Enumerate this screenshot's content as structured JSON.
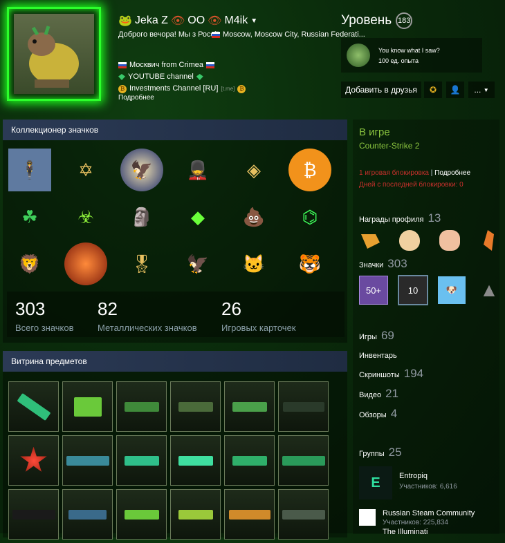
{
  "profile": {
    "name_prefix": "Jeka Z",
    "name_mid": "OO",
    "name_suffix": "M4ik",
    "greeting": "Доброго вечора! Мы з Россії",
    "location": "Moscow, Moscow City, Russian Federati...",
    "summary": {
      "line1": "Москвич from Crimea",
      "line2": "YOUTUBE channel",
      "line3": "Investments Channel [RU]",
      "line3_suffix": "[t.me]"
    },
    "more_link": "Подробнее"
  },
  "level": {
    "title": "Уровень",
    "value": "183",
    "featured_badge": {
      "name": "You know what I saw?",
      "xp": "100 ед. опыта"
    }
  },
  "actions": {
    "add_friend": "Добавить в друзья",
    "more": "..."
  },
  "badge_showcase": {
    "title": "Коллекционер значков",
    "badges": [
      "portrait",
      "star-portrait",
      "seal",
      "soldier",
      "portrait-diamond",
      "bitcoin",
      "celtic",
      "biohazard",
      "statue",
      "crystal",
      "poop-fire",
      "circuit",
      "lion",
      "lava-ball",
      "medal",
      "eagle",
      "cat",
      "tiger"
    ],
    "stats": [
      {
        "value": "303",
        "label": "Всего значков"
      },
      {
        "value": "82",
        "label": "Металлических значков"
      },
      {
        "value": "26",
        "label": "Игровых карточек"
      }
    ]
  },
  "item_showcase": {
    "title": "Витрина предметов",
    "items": [
      "knife",
      "gloves",
      "deagle",
      "mp5",
      "deagle2",
      "rifle",
      "medal",
      "awp",
      "glock",
      "mac10",
      "duals",
      "rifle2",
      "ak",
      "usp",
      "deagle3",
      "mac10b",
      "shotgun",
      "rifle3"
    ]
  },
  "status": {
    "in_game": "В игре",
    "game": "Counter-Strike 2",
    "ban_text": "1 игровая блокировка",
    "ban_sep": "|",
    "ban_more": "Подробнее",
    "days_since": "Дней с последней блокировки: 0"
  },
  "sidebar": {
    "awards_label": "Награды профиля",
    "awards_count": "13",
    "badges_label": "Значки",
    "badges_count": "303",
    "badge_level_50": "50+",
    "badge_level_10": "10",
    "games_label": "Игры",
    "games_count": "69",
    "inventory_label": "Инвентарь",
    "screenshots_label": "Скриншоты",
    "screenshots_count": "194",
    "videos_label": "Видео",
    "videos_count": "21",
    "reviews_label": "Обзоры",
    "reviews_count": "4",
    "groups_label": "Группы",
    "groups_count": "25",
    "groups": [
      {
        "name": "Entropiq",
        "members": "Участников: 6,616"
      },
      {
        "name": "Russian Steam Community",
        "members": "Участников: 225,834"
      },
      {
        "name": "The Illuminati"
      }
    ]
  },
  "colors": {
    "accent_green": "#8bc53f",
    "ban_red": "#c9302c",
    "avatar_glow": "#2bff2b"
  }
}
